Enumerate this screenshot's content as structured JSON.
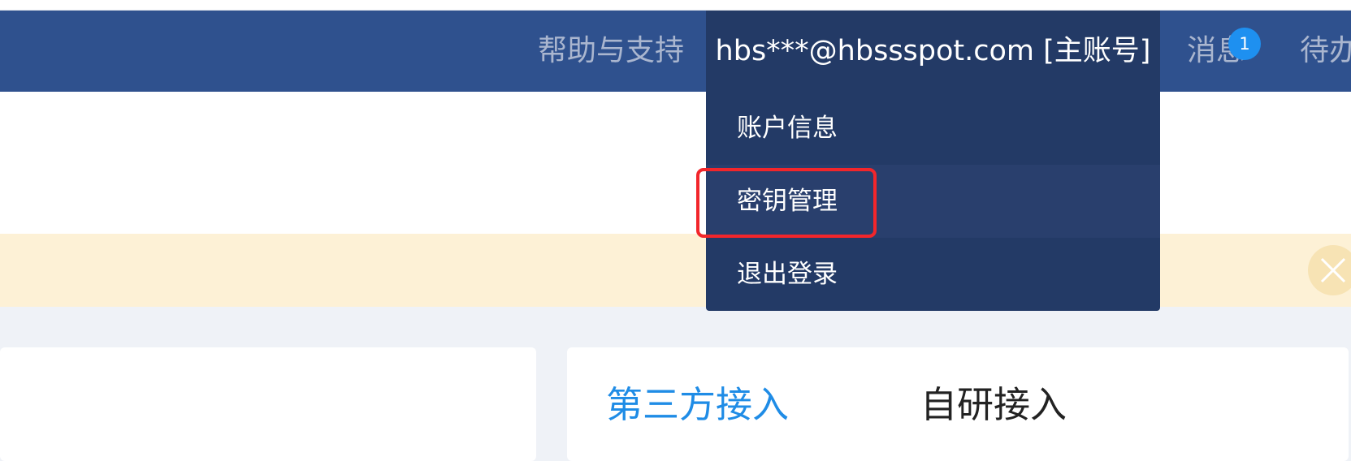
{
  "nav": {
    "help": "帮助与支持",
    "account": "hbs***@hbssspot.com [主账号]",
    "messages": "消息",
    "messages_badge": "1",
    "todo": "待办"
  },
  "account_menu": {
    "items": [
      {
        "label": "账户信息"
      },
      {
        "label": "密钥管理"
      },
      {
        "label": "退出登录"
      }
    ]
  },
  "tabs": [
    {
      "label": "第三方接入"
    },
    {
      "label": "自研接入"
    }
  ],
  "colors": {
    "nav_bg": "#2f518e",
    "menu_bg": "#233a66",
    "accent": "#1f8ce6",
    "notice_bg": "#fdf1d6",
    "highlight": "#f2262b"
  },
  "icons": {
    "notice_close": "close-icon"
  }
}
